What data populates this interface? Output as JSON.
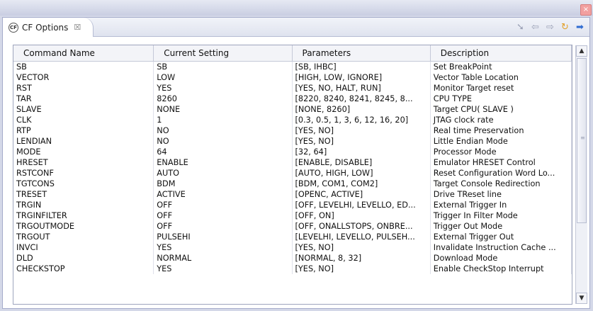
{
  "window": {
    "close_glyph": "×"
  },
  "tab": {
    "icon_text": "CF",
    "label": "CF Options",
    "close_glyph": "☒"
  },
  "toolbar": {
    "icons": [
      "pin-icon",
      "back-icon",
      "forward-icon",
      "refresh-icon",
      "go-icon"
    ]
  },
  "table": {
    "columns": [
      "Command Name",
      "Current Setting",
      "Parameters",
      "Description"
    ],
    "rows": [
      [
        "SB",
        "SB",
        "[SB, IHBC]",
        "Set BreakPoint"
      ],
      [
        "VECTOR",
        "LOW",
        "[HIGH, LOW, IGNORE]",
        "Vector Table Location"
      ],
      [
        "RST",
        "YES",
        "[YES, NO, HALT, RUN]",
        "Monitor Target reset"
      ],
      [
        "TAR",
        "8260",
        "[8220, 8240, 8241, 8245, 8...",
        "CPU TYPE"
      ],
      [
        "SLAVE",
        "NONE",
        "[NONE, 8260]",
        "Target CPU( SLAVE )"
      ],
      [
        "CLK",
        "1",
        "[0.3, 0.5, 1, 3, 6, 12, 16, 20]",
        "JTAG clock rate"
      ],
      [
        "RTP",
        "NO",
        "[YES, NO]",
        "Real time Preservation"
      ],
      [
        "LENDIAN",
        "NO",
        "[YES, NO]",
        "Little Endian Mode"
      ],
      [
        "MODE",
        "64",
        "[32, 64]",
        "Processor Mode"
      ],
      [
        "HRESET",
        "ENABLE",
        "[ENABLE, DISABLE]",
        "Emulator HRESET Control"
      ],
      [
        "RSTCONF",
        "AUTO",
        "[AUTO, HIGH, LOW]",
        "Reset Configuration Word Lo..."
      ],
      [
        "TGTCONS",
        "BDM",
        "[BDM, COM1, COM2]",
        "Target Console Redirection"
      ],
      [
        "TRESET",
        "ACTIVE",
        "[OPENC, ACTIVE]",
        "Drive TReset line"
      ],
      [
        "TRGIN",
        "OFF",
        "[OFF, LEVELHI, LEVELLO, ED...",
        "External Trigger In"
      ],
      [
        "TRGINFILTER",
        "OFF",
        "[OFF, ON]",
        "Trigger In Filter Mode"
      ],
      [
        "TRGOUTMODE",
        "OFF",
        "[OFF, ONALLSTOPS, ONBRE...",
        "Trigger Out Mode"
      ],
      [
        "TRGOUT",
        "PULSEHI",
        "[LEVELHI, LEVELLO, PULSEH...",
        "External Trigger Out"
      ],
      [
        "INVCI",
        "YES",
        "[YES, NO]",
        "Invalidate Instruction Cache ..."
      ],
      [
        "DLD",
        "NORMAL",
        "[NORMAL, 8, 32]",
        "Download Mode"
      ],
      [
        "CHECKSTOP",
        "YES",
        "[YES, NO]",
        "Enable CheckStop Interrupt"
      ]
    ]
  }
}
